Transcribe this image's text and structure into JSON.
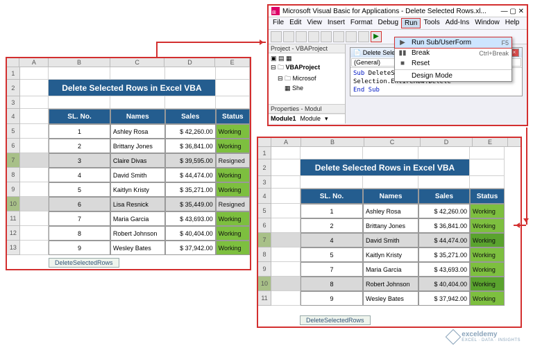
{
  "vbe": {
    "title": "Microsoft Visual Basic for Applications - Delete Selected Rows.xl...",
    "menu": [
      "File",
      "Edit",
      "View",
      "Insert",
      "Format",
      "Debug",
      "Run",
      "Tools",
      "Add-Ins",
      "Window",
      "Help"
    ],
    "project_pane": "Project - VBAProject",
    "tree": {
      "root": "VBAProject",
      "n1": "Microsof",
      "n2": "She"
    },
    "props_pane": "Properties - Modul",
    "props": {
      "name": "Module1",
      "val": "Module"
    },
    "code_title": "Delete Selected Rows",
    "combo": "(General)",
    "code": {
      "l1a": "Sub",
      "l1b": " DeleteSelectedRows()",
      "l2": "Selection.EntireRow.Delete",
      "l3": "End Sub"
    }
  },
  "run_menu": {
    "items": [
      {
        "icon": "▶",
        "label": "Run Sub/UserForm",
        "shortcut": "F5",
        "hl": true
      },
      {
        "icon": "▮▮",
        "label": "Break",
        "shortcut": "Ctrl+Break"
      },
      {
        "icon": "■",
        "label": "Reset",
        "shortcut": ""
      },
      {
        "sep": true
      },
      {
        "icon": "",
        "label": "Design Mode",
        "shortcut": ""
      }
    ]
  },
  "sheet_title": "Delete Selected Rows in Excel VBA",
  "headers": {
    "sl": "SL. No.",
    "names": "Names",
    "sales": "Sales",
    "status": "Status"
  },
  "before": {
    "cols": [
      "",
      "A",
      "B",
      "C",
      "D",
      "E"
    ],
    "rows": [
      {
        "sl": "1",
        "name": "Ashley Rosa",
        "sales": "$   42,260.00",
        "status": "Working",
        "st": "w"
      },
      {
        "sl": "2",
        "name": "Brittany Jones",
        "sales": "$   36,841.00",
        "status": "Working",
        "st": "w"
      },
      {
        "sl": "3",
        "name": "Claire Divas",
        "sales": "$   39,595.00",
        "status": "Resigned",
        "st": "r",
        "sel": true
      },
      {
        "sl": "4",
        "name": "David Smith",
        "sales": "$   44,474.00",
        "status": "Working",
        "st": "w"
      },
      {
        "sl": "5",
        "name": "Kaitlyn Kristy",
        "sales": "$   35,271.00",
        "status": "Working",
        "st": "w"
      },
      {
        "sl": "6",
        "name": "Lisa Resnick",
        "sales": "$   35,449.00",
        "status": "Resigned",
        "st": "r",
        "sel": true
      },
      {
        "sl": "7",
        "name": "Maria Garcia",
        "sales": "$   43,693.00",
        "status": "Working",
        "st": "w"
      },
      {
        "sl": "8",
        "name": "Robert Johnson",
        "sales": "$   40,404.00",
        "status": "Working",
        "st": "w"
      },
      {
        "sl": "9",
        "name": "Wesley Bates",
        "sales": "$   37,942.00",
        "status": "Working",
        "st": "w"
      }
    ],
    "tab": "DeleteSelectedRows"
  },
  "after": {
    "cols": [
      "",
      "A",
      "B",
      "C",
      "D",
      "E"
    ],
    "rows": [
      {
        "sl": "1",
        "name": "Ashley Rosa",
        "sales": "$   42,260.00",
        "status": "Working",
        "st": "w"
      },
      {
        "sl": "2",
        "name": "Brittany Jones",
        "sales": "$   36,841.00",
        "status": "Working",
        "st": "w"
      },
      {
        "sl": "4",
        "name": "David Smith",
        "sales": "$   44,474.00",
        "status": "Working",
        "st": "w2",
        "sel": true
      },
      {
        "sl": "5",
        "name": "Kaitlyn Kristy",
        "sales": "$   35,271.00",
        "status": "Working",
        "st": "w"
      },
      {
        "sl": "7",
        "name": "Maria Garcia",
        "sales": "$   43,693.00",
        "status": "Working",
        "st": "w"
      },
      {
        "sl": "8",
        "name": "Robert Johnson",
        "sales": "$   40,404.00",
        "status": "Working",
        "st": "w2",
        "sel": true
      },
      {
        "sl": "9",
        "name": "Wesley Bates",
        "sales": "$   37,942.00",
        "status": "Working",
        "st": "w"
      }
    ],
    "tab": "DeleteSelectedRows"
  },
  "watermark": {
    "brand": "exceldemy",
    "tag": "EXCEL · DATA · INSIGHTS"
  }
}
